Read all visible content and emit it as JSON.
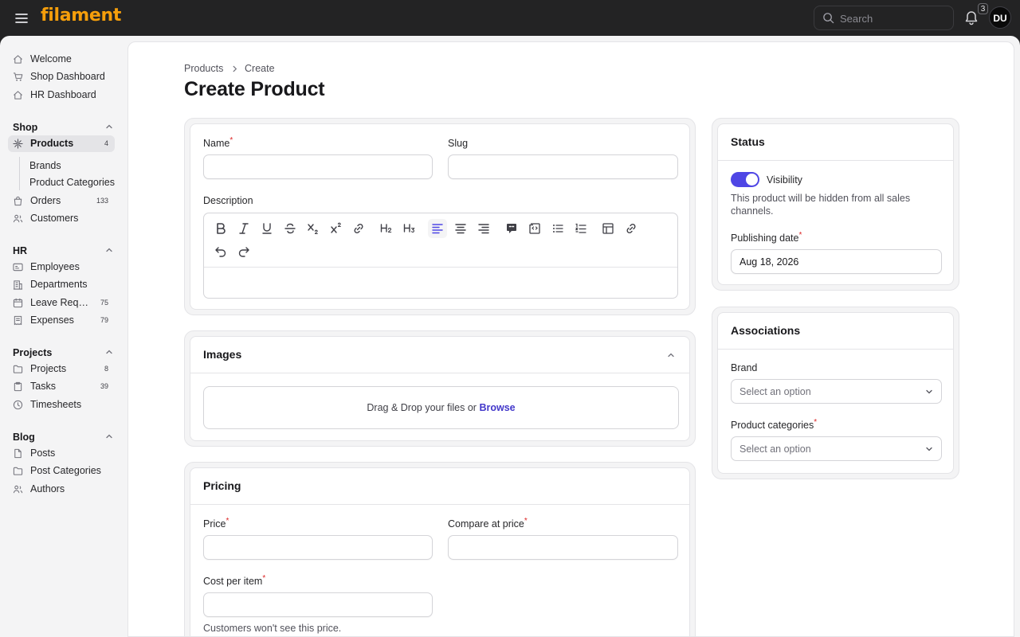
{
  "app": {
    "brand": "filament"
  },
  "topbar": {
    "search_placeholder": "Search",
    "notifications_count": "3",
    "avatar_initials": "DU"
  },
  "sidebar": {
    "top_items": [
      {
        "label": "Welcome",
        "icon": "home-icon"
      },
      {
        "label": "Shop Dashboard",
        "icon": "shopping-cart-icon"
      },
      {
        "label": "HR Dashboard",
        "icon": "home-icon"
      }
    ],
    "groups": {
      "shop": {
        "label": "Shop",
        "items": [
          {
            "label": "Products",
            "count": "4",
            "icon": "bolt-icon",
            "active": true
          },
          {
            "label": "Orders",
            "count": "133",
            "icon": "shopping-bag-icon"
          },
          {
            "label": "Customers",
            "icon": "users-icon"
          }
        ],
        "sub_items": [
          "Brands",
          "Product Categories"
        ]
      },
      "hr": {
        "label": "HR",
        "items": [
          {
            "label": "Employees",
            "icon": "id-card-icon"
          },
          {
            "label": "Departments",
            "icon": "building-icon"
          },
          {
            "label": "Leave Req…",
            "count": "75",
            "icon": "calendar-icon"
          },
          {
            "label": "Expenses",
            "count": "79",
            "icon": "receipt-icon"
          }
        ]
      },
      "projects": {
        "label": "Projects",
        "items": [
          {
            "label": "Projects",
            "count": "8",
            "icon": "folder-icon"
          },
          {
            "label": "Tasks",
            "count": "39",
            "icon": "clipboard-icon"
          },
          {
            "label": "Timesheets",
            "icon": "clock-icon"
          }
        ]
      },
      "blog": {
        "label": "Blog",
        "items": [
          {
            "label": "Posts",
            "icon": "document-icon"
          },
          {
            "label": "Post Categories",
            "icon": "folder-icon"
          },
          {
            "label": "Authors",
            "icon": "users-icon"
          }
        ]
      }
    }
  },
  "breadcrumb": [
    "Products",
    "Create"
  ],
  "page_title": "Create Product",
  "form": {
    "name_label": "Name",
    "slug_label": "Slug",
    "description_label": "Description",
    "name_value": "",
    "slug_value": ""
  },
  "images": {
    "title": "Images",
    "drop_text": "Drag & Drop your files or",
    "browse": "Browse"
  },
  "pricing": {
    "title": "Pricing",
    "price_label": "Price",
    "compare_label": "Compare at price",
    "cost_label": "Cost per item",
    "cost_hint": "Customers won't see this price."
  },
  "status": {
    "title": "Status",
    "visibility_label": "Visibility",
    "visibility_on": true,
    "visibility_hint": "This product will be hidden from all sales channels.",
    "publishing_label": "Publishing date",
    "publishing_value": "Aug 18, 2026"
  },
  "associations": {
    "title": "Associations",
    "brand_label": "Brand",
    "brand_placeholder": "Select an option",
    "categories_label": "Product categories",
    "categories_placeholder": "Select an option"
  },
  "colors": {
    "brand": "#f59e0b",
    "primary": "#4f46e5",
    "required": "#dc2626",
    "topbar": "#232324"
  }
}
